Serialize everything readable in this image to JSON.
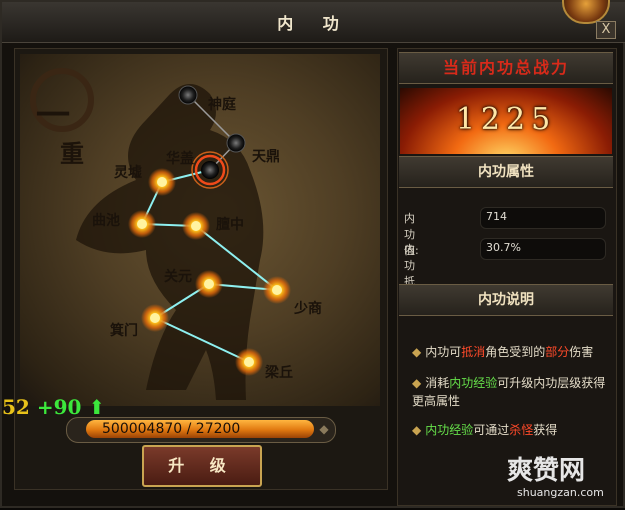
{
  "window": {
    "title": "内 功",
    "close_label": "X"
  },
  "left": {
    "rank_char_a": "一",
    "rank_char_b": "重",
    "nodes": [
      {
        "label": "神庭",
        "state": "locked"
      },
      {
        "label": "天鼎",
        "state": "locked"
      },
      {
        "label": "华盖",
        "state": "selected"
      },
      {
        "label": "灵墟",
        "state": "lit"
      },
      {
        "label": "曲池",
        "state": "lit"
      },
      {
        "label": "膻中",
        "state": "lit"
      },
      {
        "label": "关元",
        "state": "lit"
      },
      {
        "label": "少商",
        "state": "lit"
      },
      {
        "label": "箕门",
        "state": "lit"
      },
      {
        "label": "梁丘",
        "state": "lit"
      }
    ],
    "stats": {
      "base": "52",
      "bonus": "+90",
      "arrow": "⬆"
    },
    "progress": {
      "text": "500004870 / 27200",
      "fill": 1.0
    },
    "upgrade_label": "升 级"
  },
  "right": {
    "power_header": "当前内功总战力",
    "power_value": "1225",
    "attr_header": "内功属性",
    "attrs": [
      {
        "label": "内功值:",
        "value": "714"
      },
      {
        "label": "内功抵伤:",
        "value": "30.7%"
      }
    ],
    "desc_header": "内功说明",
    "desc": [
      {
        "pre": "内功可",
        "hl": "抵消",
        "mid": "角色受到的",
        "hl2": "部分",
        "post": "伤害"
      },
      {
        "pre": "消耗",
        "hl": "内功经验",
        "post": "可升级内功层级获得更高属性"
      },
      {
        "hl": "内功经验",
        "pre": "可通过",
        "hl2": "杀怪",
        "post": "获得"
      }
    ]
  },
  "watermark": {
    "main": "爽赞网",
    "sub": "shuangzan.com"
  },
  "colors": {
    "accent_gold": "#c9a451",
    "fire": "#f26a12",
    "green": "#3ce83c",
    "red": "#ff4a2a"
  }
}
